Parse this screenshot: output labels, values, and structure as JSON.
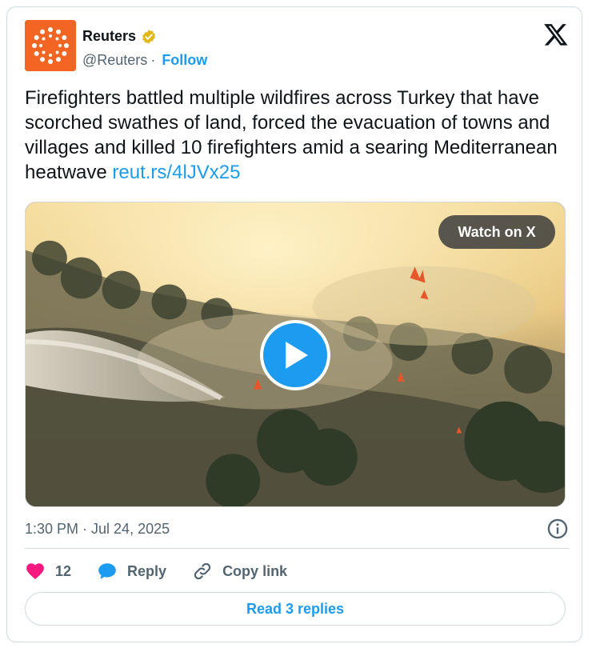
{
  "account": {
    "name": "Reuters",
    "handle": "@Reuters",
    "separator": "·",
    "follow_label": "Follow",
    "verified": true,
    "brand_color": "#f26522",
    "verified_color": "#e2b719"
  },
  "tweet": {
    "text": "Firefighters battled multiple wildfires across Turkey that have scorched swathes of land, forced the evacuation of towns and villages and killed 10 firefighters amid a searing Mediterranean heatwave ",
    "link_text": "reut.rs/4lJVx25",
    "link_color": "#1d9bf0"
  },
  "media": {
    "watch_label": "Watch on X",
    "play_icon": "play-icon"
  },
  "meta": {
    "timestamp": "1:30 PM · Jul 24, 2025"
  },
  "actions": {
    "like_count": "12",
    "reply_label": "Reply",
    "copy_link_label": "Copy link",
    "like_color": "#f91880",
    "reply_color": "#1d9bf0"
  },
  "footer": {
    "read_replies_label": "Read 3 replies"
  }
}
